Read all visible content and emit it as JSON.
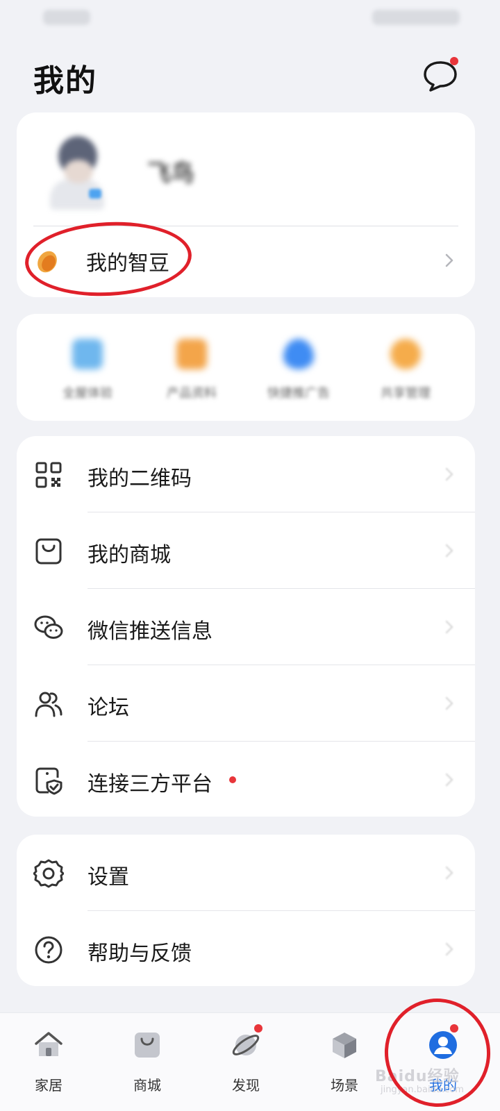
{
  "header": {
    "title": "我的"
  },
  "profile": {
    "username": "飞鸟"
  },
  "zhidou": {
    "label": "我的智豆"
  },
  "quick_actions": [
    {
      "label": "全屋体验",
      "color": "#6fb7ee"
    },
    {
      "label": "产品资料",
      "color": "#f3a54a"
    },
    {
      "label": "快捷推广告",
      "color": "#3f8cf3"
    },
    {
      "label": "共享管理",
      "color": "#f5ac4b"
    }
  ],
  "menu": {
    "items": [
      {
        "label": "我的二维码",
        "icon": "qr-code-icon"
      },
      {
        "label": "我的商城",
        "icon": "shopping-bag-icon"
      },
      {
        "label": "微信推送信息",
        "icon": "wechat-icon"
      },
      {
        "label": "论坛",
        "icon": "users-icon"
      },
      {
        "label": "连接三方平台",
        "icon": "device-shield-icon",
        "badge": true
      }
    ],
    "items2": [
      {
        "label": "设置",
        "icon": "gear-icon"
      },
      {
        "label": "帮助与反馈",
        "icon": "help-icon"
      }
    ]
  },
  "tabs": [
    {
      "label": "家居",
      "icon": "home-icon"
    },
    {
      "label": "商城",
      "icon": "bag-icon"
    },
    {
      "label": "发现",
      "icon": "planet-icon",
      "badge": true
    },
    {
      "label": "场景",
      "icon": "cube-icon"
    },
    {
      "label": "我的",
      "icon": "profile-icon",
      "active": true,
      "badge": true
    }
  ],
  "watermark": {
    "text": "Baidu经验",
    "sub": "jingyan.baidu.com"
  },
  "colors": {
    "accent": "#1f6de0",
    "badge_red": "#e8353a",
    "annotation_red": "#e0202a"
  }
}
